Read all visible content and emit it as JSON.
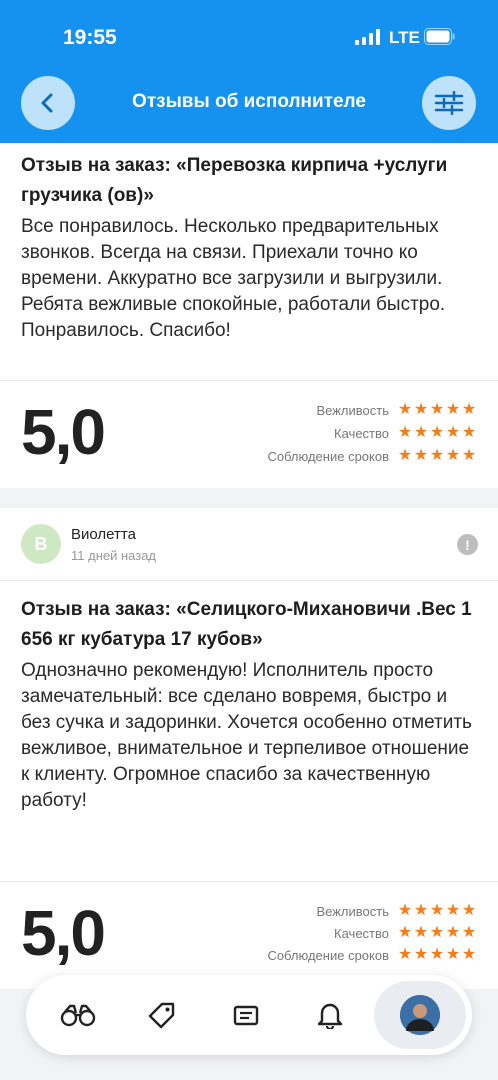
{
  "status_bar": {
    "time": "19:55",
    "network": "LTE"
  },
  "header": {
    "title": "Отзывы об исполнителе",
    "back_icon": "chevron-left-icon",
    "filter_icon": "sliders-icon"
  },
  "colors": {
    "accent": "#1592f0",
    "star": "#f57e1c",
    "avatar_bg": "#cde8c3"
  },
  "reviews": [
    {
      "order_title": "Отзыв на заказ: «Перевозка кирпича +услуги грузчика (ов)»",
      "text": "Все понравилось. Несколько предварительных звонков. Всегда на связи. Приехали точно ко времени. Аккуратно все загрузили и выгрузили. Ребята вежливые спокойные, работали быстро. Понравилось. Спасибо!",
      "rating": "5,0",
      "criteria": [
        {
          "label": "Вежливость",
          "stars": 5
        },
        {
          "label": "Качество",
          "stars": 5
        },
        {
          "label": "Соблюдение сроков",
          "stars": 5
        }
      ]
    },
    {
      "author_initial": "В",
      "author_name": "Виолетта",
      "date": "11 дней назад",
      "order_title": "Отзыв на заказ: «Селицкого-Михановичи .Вес 1 656 кг кубатура 17 кубов»",
      "text": "Однозначно рекомендую! Исполнитель просто замечательный: все сделано вовремя, быстро и без сучка и задоринки. Хочется особенно отметить вежливое, внимательное и терпеливое отношение к клиенту. Огромное спасибо за качественную работу!",
      "rating": "5,0",
      "criteria": [
        {
          "label": "Вежливость",
          "stars": 5
        },
        {
          "label": "Качество",
          "stars": 5
        },
        {
          "label": "Соблюдение сроков",
          "stars": 5
        }
      ]
    }
  ],
  "tabbar": {
    "items": [
      "binoculars-icon",
      "tag-icon",
      "orders-icon",
      "bell-icon",
      "profile-avatar"
    ]
  }
}
